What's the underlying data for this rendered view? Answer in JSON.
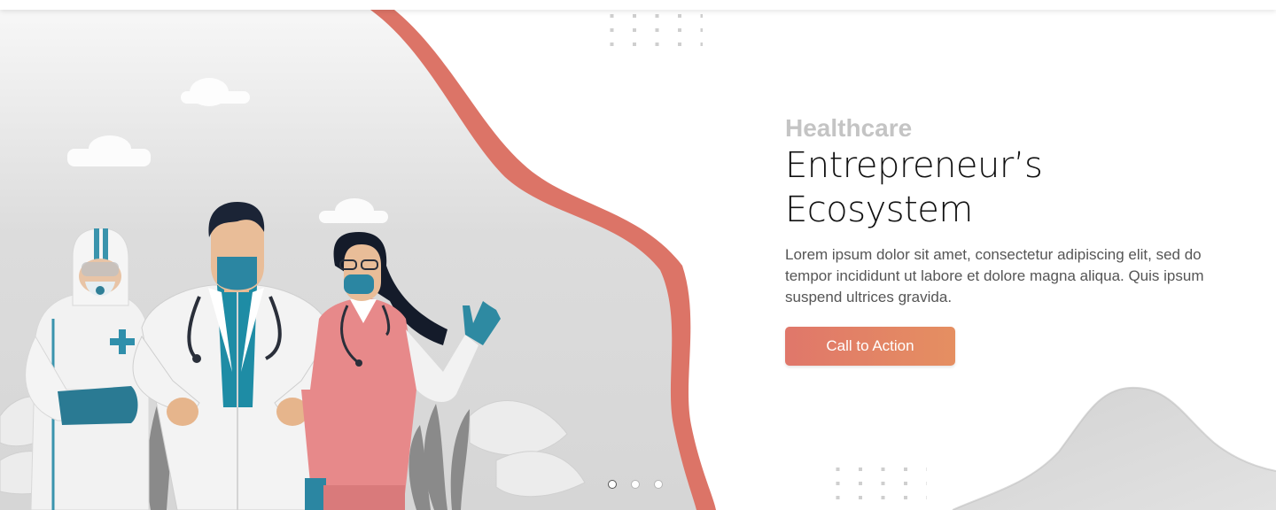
{
  "hero": {
    "kicker": "Healthcare",
    "headline": "Entrepreneur’s Ecosystem",
    "body": "Lorem ipsum dolor sit amet, consectetur adipiscing elit, sed do tempor incididunt ut labore et dolore magna aliqua. Quis ipsum suspend ultrices gravida.",
    "cta_label": "Call to Action"
  },
  "carousel": {
    "slide_count": 3,
    "active_index": 0
  },
  "colors": {
    "accent": "#e0776a",
    "accent_end": "#e58f61",
    "kicker": "#c4c4c4",
    "headline": "#111111",
    "body": "#555555",
    "illustration_bg": "#dcdcdc",
    "blob": "#d9d9d9"
  },
  "illustration": {
    "figures": [
      "hazmat-worker",
      "doctor",
      "nurse"
    ]
  }
}
